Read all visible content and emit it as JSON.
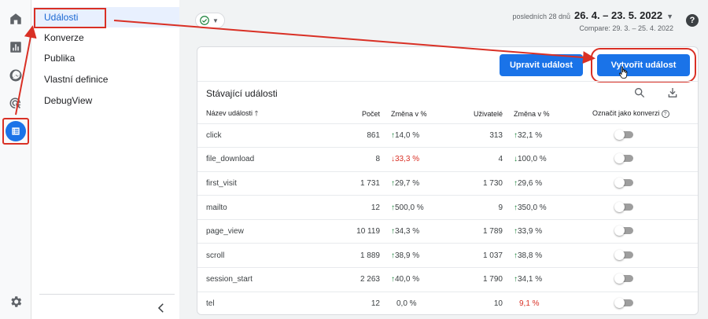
{
  "rail": {
    "icons": [
      "home-icon",
      "reports-icon",
      "explore-icon",
      "advertising-icon",
      "configure-icon",
      "settings-icon"
    ]
  },
  "subnav": {
    "items": [
      {
        "label": "Události",
        "active": true
      },
      {
        "label": "Konverze"
      },
      {
        "label": "Publika"
      },
      {
        "label": "Vlastní definice"
      },
      {
        "label": "DebugView"
      }
    ]
  },
  "topbar": {
    "date_label": "posledních 28 dnů",
    "date_range": "26. 4. – 23. 5. 2022",
    "compare": "Compare: 29. 3. – 25. 4. 2022",
    "help": "?"
  },
  "card": {
    "edit_button": "Upravit událost",
    "create_button": "Vytvořit událost",
    "section_title": "Stávající události"
  },
  "table": {
    "headers": {
      "name": "Název události",
      "count": "Počet",
      "change1": "Změna v %",
      "users": "Uživatelé",
      "change2": "Změna v %",
      "conversion": "Označit jako konverzi"
    },
    "rows": [
      {
        "name": "click",
        "count": "861",
        "change1": "14,0 %",
        "dir1": "up",
        "users": "313",
        "change2": "32,1 %",
        "dir2": "up"
      },
      {
        "name": "file_download",
        "count": "8",
        "change1": "33,3 %",
        "dir1": "down",
        "users": "4",
        "change2": "100,0 %",
        "dir2": "down"
      },
      {
        "name": "first_visit",
        "count": "1 731",
        "change1": "29,7 %",
        "dir1": "up",
        "users": "1 730",
        "change2": "29,6 %",
        "dir2": "up"
      },
      {
        "name": "mailto",
        "count": "12",
        "change1": "500,0 %",
        "dir1": "up",
        "users": "9",
        "change2": "350,0 %",
        "dir2": "up"
      },
      {
        "name": "page_view",
        "count": "10 119",
        "change1": "34,3 %",
        "dir1": "up",
        "users": "1 789",
        "change2": "33,9 %",
        "dir2": "up"
      },
      {
        "name": "scroll",
        "count": "1 889",
        "change1": "38,9 %",
        "dir1": "up",
        "users": "1 037",
        "change2": "38,8 %",
        "dir2": "up"
      },
      {
        "name": "session_start",
        "count": "2 263",
        "change1": "40,0 %",
        "dir1": "up",
        "users": "1 790",
        "change2": "34,1 %",
        "dir2": "up"
      },
      {
        "name": "tel",
        "count": "12",
        "change1": "0,0 %",
        "dir1": "none",
        "users": "10",
        "change2": "9,1 %",
        "dir2": "neg"
      }
    ]
  },
  "colors": {
    "accent": "#1a73e8",
    "annotation": "#d93025",
    "positive": "#188038",
    "negative": "#d93025"
  }
}
